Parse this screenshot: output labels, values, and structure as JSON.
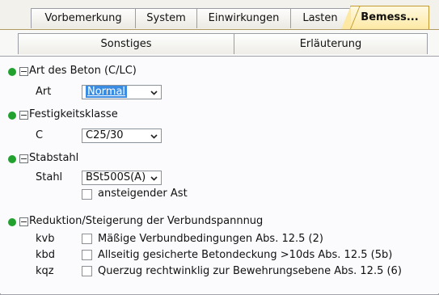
{
  "tabs": [
    "Vorbemerkung",
    "System",
    "Einwirkungen",
    "Lasten",
    "Bemess..."
  ],
  "subtabs": [
    "Sonstiges",
    "Erläuterung"
  ],
  "sections": {
    "beton": {
      "title": "Art des Beton (C/LC)",
      "label": "Art",
      "value": "Normal"
    },
    "festigkeit": {
      "title": "Festigkeitsklasse",
      "label": "C",
      "value": "C25/30"
    },
    "stabstahl": {
      "title": "Stabstahl",
      "label": "Stahl",
      "value": "BSt500S(A)",
      "checkbox_label": "ansteigender Ast"
    },
    "verbund": {
      "title": "Reduktion/Steigerung der Verbundspannnug",
      "rows": [
        {
          "label": "kvb",
          "text": "Mäßige Verbundbedingungen Abs. 12.5 (2)"
        },
        {
          "label": "kbd",
          "text": "Allseitig gesicherte Betondeckung >10ds Abs. 12.5 (5b)"
        },
        {
          "label": "kqz",
          "text": "Querzug rechtwinklig zur Bewehrungsebene Abs. 12.5 (6)"
        }
      ]
    }
  },
  "colors": {
    "dot": "#22a12f",
    "active_tab": "#fde9a4",
    "selection": "#3a8ce3"
  }
}
